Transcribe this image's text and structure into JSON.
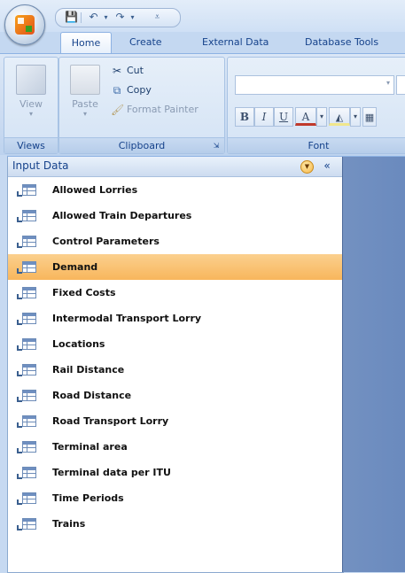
{
  "ribbon_tabs": [
    "Home",
    "Create",
    "External Data",
    "Database Tools"
  ],
  "active_tab": "Home",
  "views_group": {
    "label": "Views",
    "view_button": "View"
  },
  "clipboard_group": {
    "label": "Clipboard",
    "paste": "Paste",
    "cut": "Cut",
    "copy": "Copy",
    "format_painter": "Format Painter"
  },
  "font_group": {
    "label": "Font",
    "bold": "B",
    "italic": "I",
    "underline": "U",
    "font_color": "A"
  },
  "nav_pane": {
    "title": "Input Data",
    "items": [
      {
        "label": "Allowed Lorries"
      },
      {
        "label": "Allowed Train Departures"
      },
      {
        "label": "Control Parameters"
      },
      {
        "label": "Demand"
      },
      {
        "label": "Fixed Costs"
      },
      {
        "label": "Intermodal Transport Lorry"
      },
      {
        "label": "Locations"
      },
      {
        "label": "Rail Distance"
      },
      {
        "label": "Road Distance"
      },
      {
        "label": "Road Transport Lorry"
      },
      {
        "label": "Terminal area"
      },
      {
        "label": "Terminal data per ITU"
      },
      {
        "label": "Time Periods"
      },
      {
        "label": "Trains"
      }
    ],
    "selected_item": "Demand"
  },
  "colors": {
    "selection": "#f8b65c",
    "workspace": "#6a8abe",
    "accent": "#15428b"
  }
}
